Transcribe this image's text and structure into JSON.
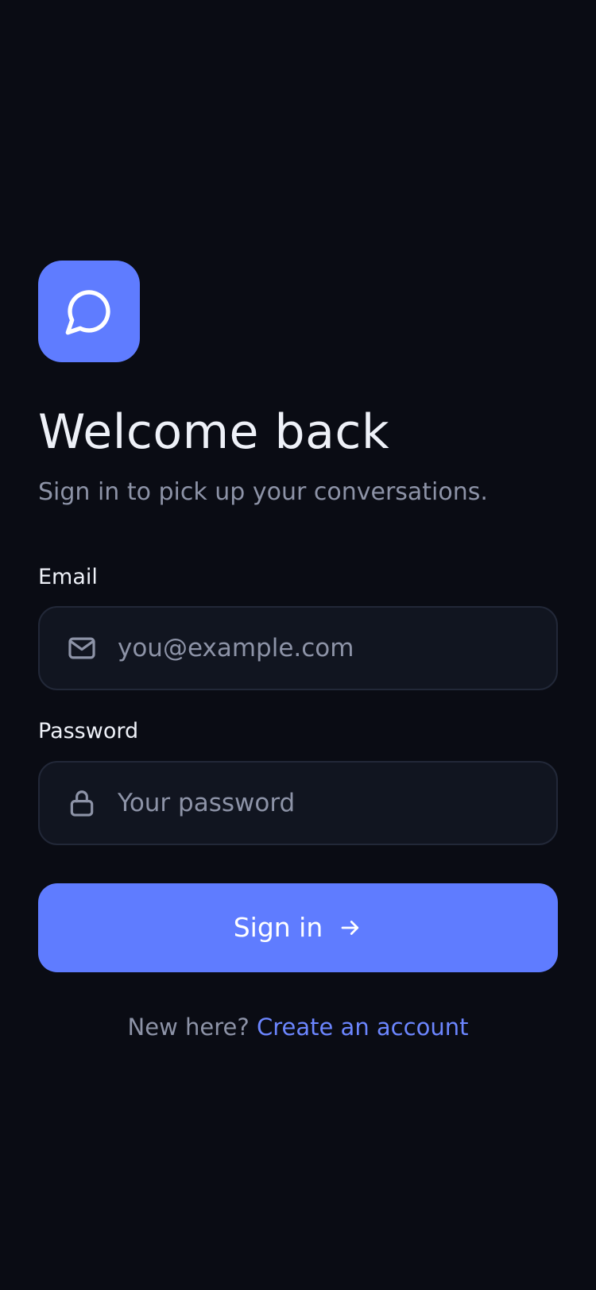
{
  "header": {
    "logo_icon": "chat-bubble-icon",
    "title": "Welcome back",
    "subtitle": "Sign in to pick up your conversations."
  },
  "form": {
    "email": {
      "label": "Email",
      "icon": "mail-icon",
      "value": "",
      "placeholder": "you@example.com"
    },
    "password": {
      "label": "Password",
      "icon": "lock-icon",
      "value": "",
      "placeholder": "Your password"
    },
    "submit": {
      "label": "Sign in",
      "icon": "arrow-right-icon"
    }
  },
  "footer": {
    "prompt": "New here?",
    "link_label": "Create an account"
  },
  "colors": {
    "background": "#0a0c14",
    "accent": "#5f7cff",
    "link": "#6c86ff",
    "field_background": "#111520",
    "field_border": "#222838",
    "muted_text": "#8d93a7",
    "primary_text": "#eef1f8"
  }
}
